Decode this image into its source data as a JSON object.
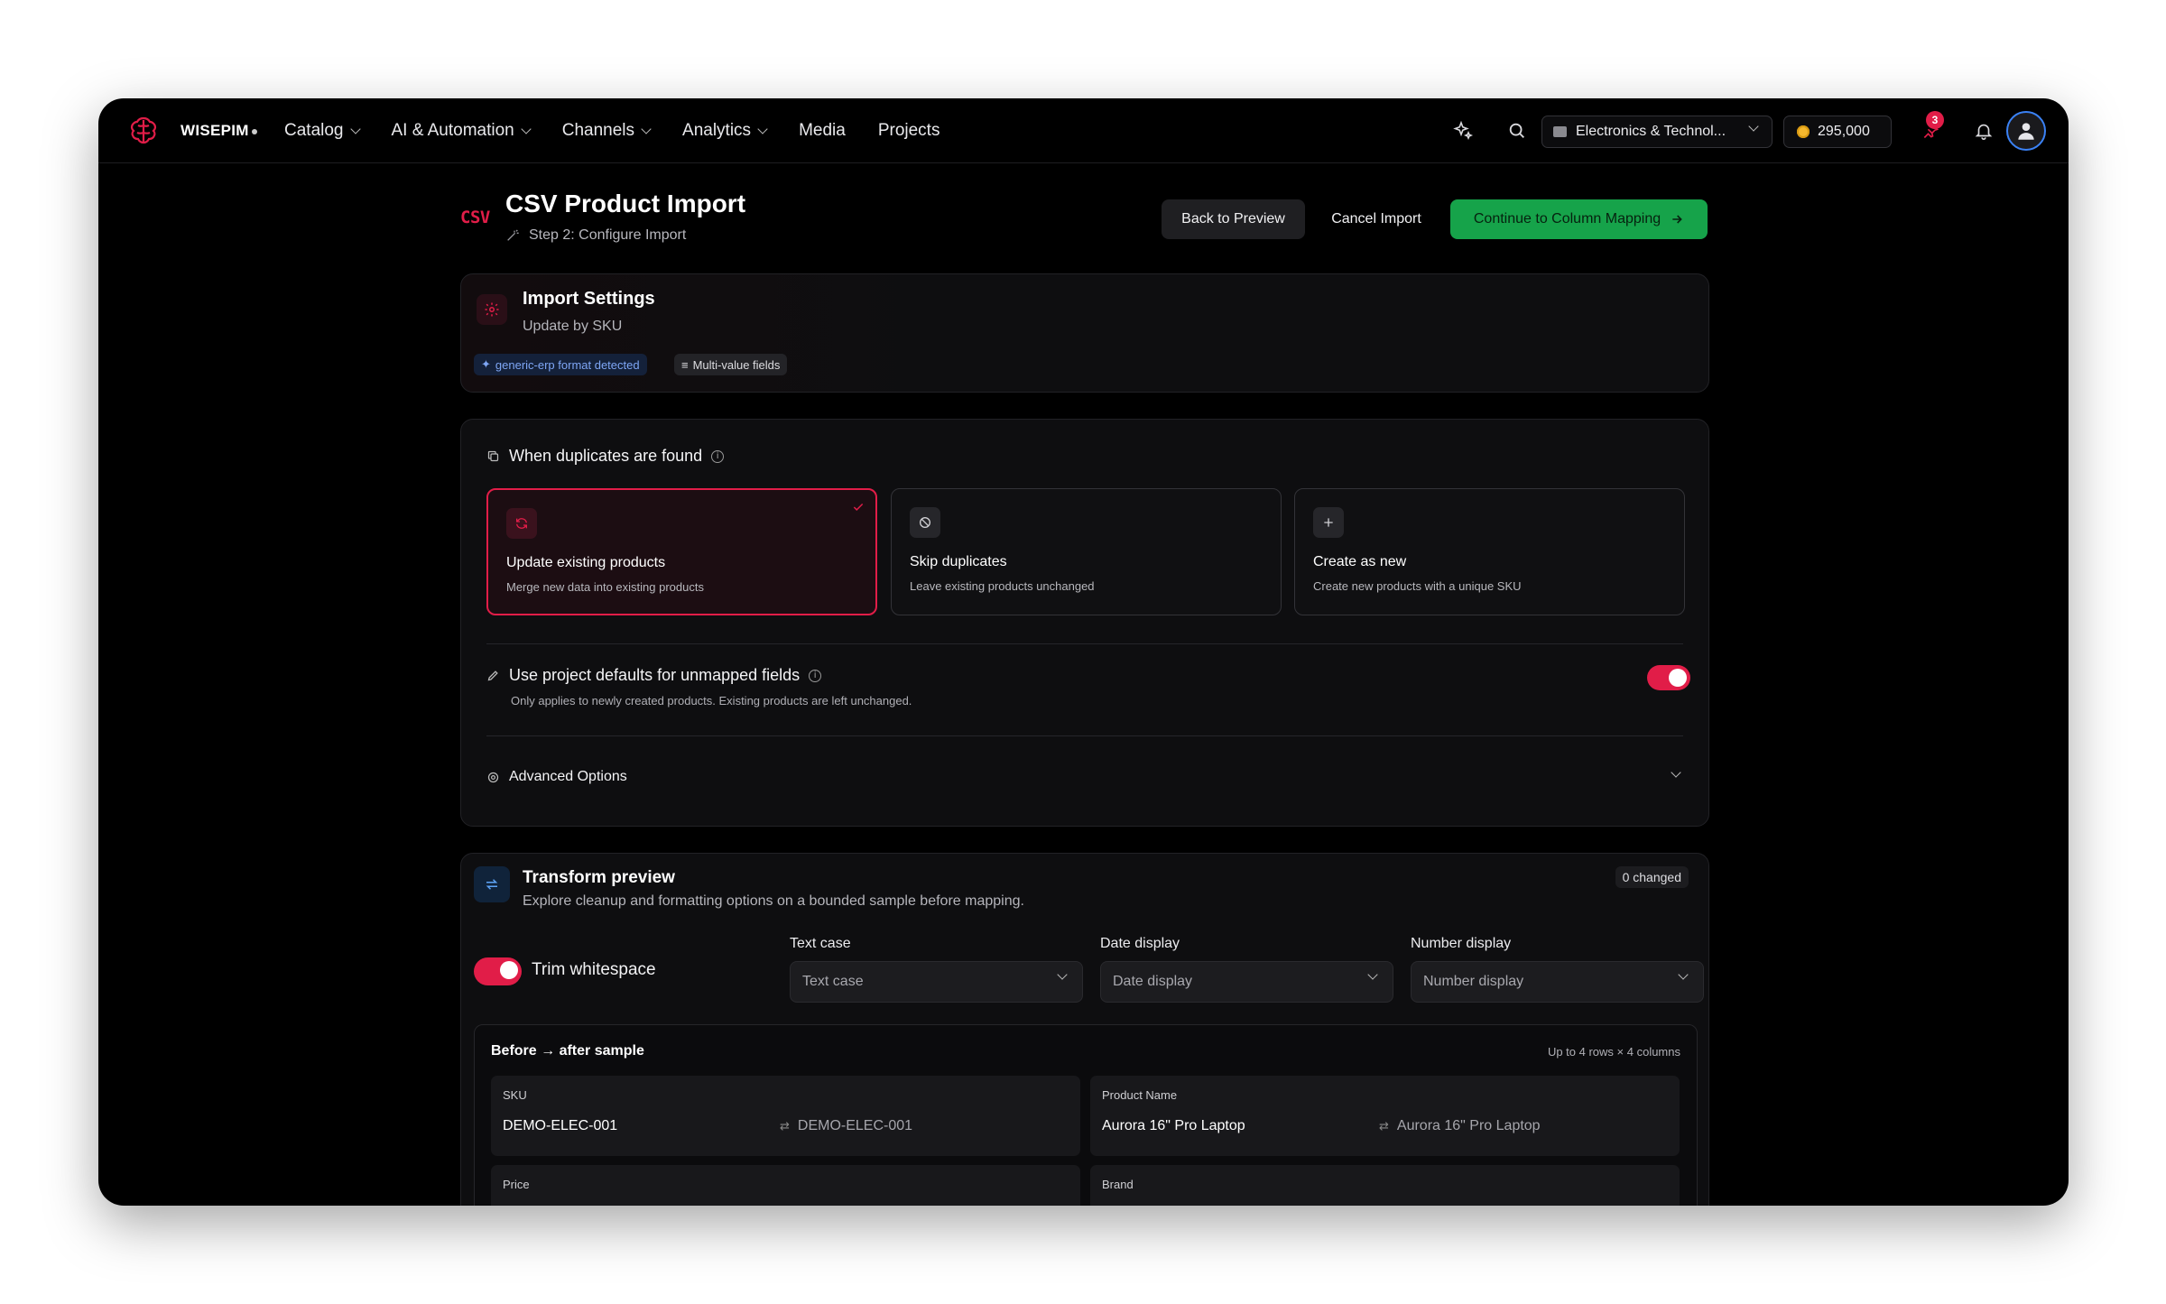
{
  "nav": {
    "brand": "WISEPIM",
    "menu": [
      {
        "label": "Catalog",
        "dropdown": true
      },
      {
        "label": "AI & Automation",
        "dropdown": true
      },
      {
        "label": "Channels",
        "dropdown": true
      },
      {
        "label": "Analytics",
        "dropdown": true
      },
      {
        "label": "Media",
        "dropdown": false
      },
      {
        "label": "Projects",
        "dropdown": false
      }
    ],
    "workspace": "Electronics & Technol...",
    "credits": "295,000",
    "notification_count": "3"
  },
  "header": {
    "badge": "CSV",
    "title": "CSV Product Import",
    "step": "Step 2: Configure Import",
    "back_button": "Back to Preview",
    "cancel_button": "Cancel Import",
    "continue_button": "Continue to Column Mapping"
  },
  "import_settings": {
    "title": "Import Settings",
    "subtitle": "Update by SKU",
    "chips": [
      "generic-erp format detected",
      "Multi-value fields"
    ]
  },
  "duplicates": {
    "label": "When duplicates are found",
    "options": [
      {
        "title": "Update existing products",
        "desc": "Merge new data into existing products",
        "selected": true
      },
      {
        "title": "Skip duplicates",
        "desc": "Leave existing products unchanged",
        "selected": false
      },
      {
        "title": "Create as new",
        "desc": "Create new products with a unique SKU",
        "selected": false
      }
    ],
    "defaults_label": "Use project defaults for unmapped fields",
    "defaults_desc": "Only applies to newly created products. Existing products are left unchanged.",
    "defaults_enabled": true,
    "advanced_label": "Advanced Options"
  },
  "transform": {
    "title": "Transform preview",
    "subtitle": "Explore cleanup and formatting options on a bounded sample before mapping.",
    "changed_badge": "0 changed",
    "trim_label": "Trim whitespace",
    "trim_enabled": true,
    "text_case_label": "Text case",
    "text_case_value": "Text case",
    "date_label": "Date display",
    "date_value": "Date display",
    "number_label": "Number display",
    "number_value": "Number display",
    "sample_title": "Before → after sample",
    "sample_meta": "Up to 4 rows × 4 columns",
    "columns": [
      {
        "name": "SKU",
        "before": "DEMO-ELEC-001",
        "after": "DEMO-ELEC-001"
      },
      {
        "name": "Product Name",
        "before": "Aurora 16\" Pro Laptop",
        "after": "Aurora 16\" Pro Laptop"
      },
      {
        "name": "Price",
        "before": "",
        "after": ""
      },
      {
        "name": "Brand",
        "before": "",
        "after": ""
      }
    ]
  },
  "colors": {
    "accent": "#e11d48",
    "success": "#16a34a",
    "background": "#000000"
  }
}
